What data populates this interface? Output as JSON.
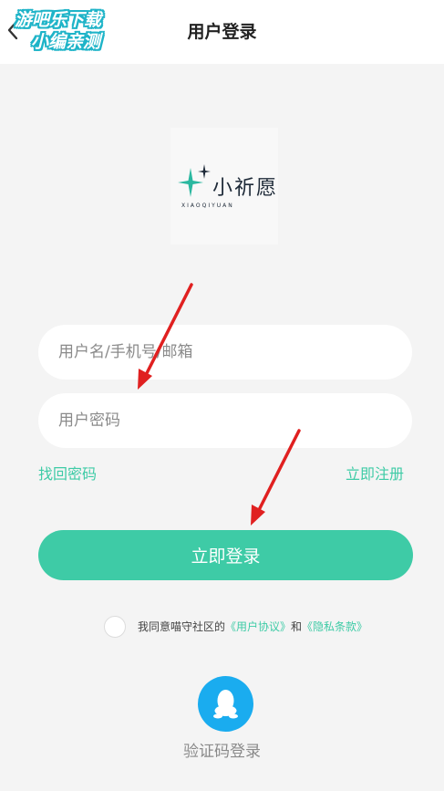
{
  "header": {
    "title": "用户登录",
    "back_icon": "chevron-left-icon",
    "watermark": {
      "line1": "游吧乐下载",
      "line2": "小编亲测"
    }
  },
  "logo": {
    "name": "小祈愿",
    "subtitle": "XIAOQIYUAN",
    "icon": "sparkle-star-icon"
  },
  "form": {
    "username_placeholder": "用户名/手机号/邮箱",
    "username_value": "",
    "password_placeholder": "用户密码",
    "password_value": ""
  },
  "links": {
    "forgot_password": "找回密码",
    "register": "立即注册"
  },
  "login_button": "立即登录",
  "agreement": {
    "checked": false,
    "prefix": "我同意喵守社区的",
    "user_agreement": "《用户协议》",
    "and": "和",
    "privacy": "《隐私条款》"
  },
  "alt_login": {
    "icon": "qq-penguin-icon",
    "sms_label": "验证码登录"
  },
  "colors": {
    "accent": "#3ecba6",
    "qq_blue": "#1aacef",
    "annotation_red": "#e02020"
  }
}
